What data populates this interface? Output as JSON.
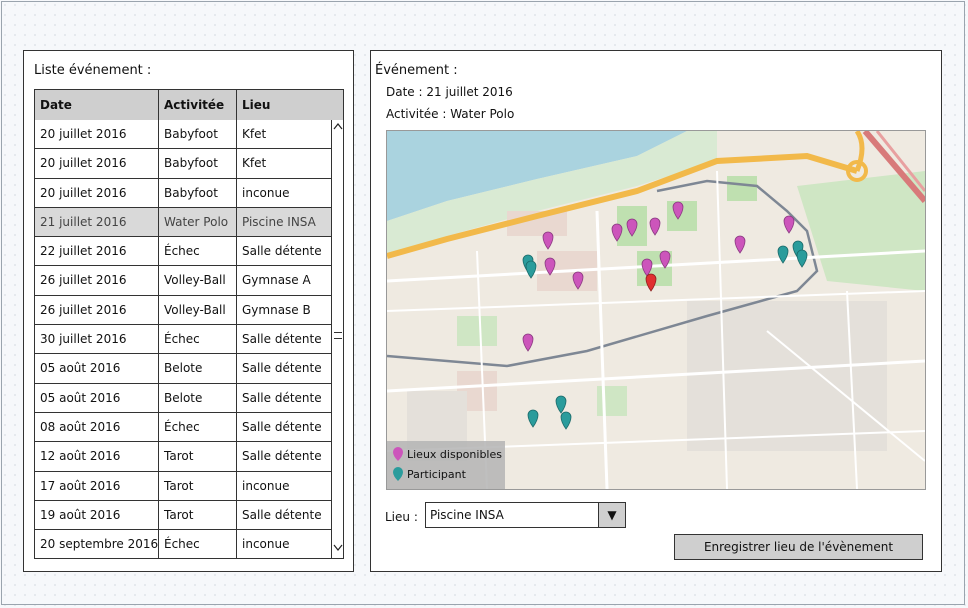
{
  "left_panel": {
    "title": "Liste événement :",
    "columns": [
      "Date",
      "Activitée",
      "Lieu"
    ],
    "rows": [
      {
        "date": "20 juillet 2016",
        "activity": "Babyfoot",
        "place": "Kfet",
        "selected": false
      },
      {
        "date": "20 juillet 2016",
        "activity": "Babyfoot",
        "place": "Kfet",
        "selected": false
      },
      {
        "date": "20 juillet 2016",
        "activity": "Babyfoot",
        "place": "inconue",
        "selected": false
      },
      {
        "date": "21 juillet 2016",
        "activity": "Water Polo",
        "place": "Piscine INSA",
        "selected": true
      },
      {
        "date": "22 juillet 2016",
        "activity": "Échec",
        "place": "Salle détente",
        "selected": false
      },
      {
        "date": "26 juillet 2016",
        "activity": "Volley-Ball",
        "place": "Gymnase A",
        "selected": false
      },
      {
        "date": "26 juillet 2016",
        "activity": "Volley-Ball",
        "place": "Gymnase B",
        "selected": false
      },
      {
        "date": "30 juillet 2016",
        "activity": "Échec",
        "place": "Salle détente",
        "selected": false
      },
      {
        "date": "05 août 2016",
        "activity": "Belote",
        "place": "Salle détente",
        "selected": false
      },
      {
        "date": "05 août 2016",
        "activity": "Belote",
        "place": "Salle détente",
        "selected": false
      },
      {
        "date": "08 août 2016",
        "activity": "Échec",
        "place": "Salle détente",
        "selected": false
      },
      {
        "date": "12 août 2016",
        "activity": "Tarot",
        "place": "Salle détente",
        "selected": false
      },
      {
        "date": "17 août 2016",
        "activity": "Tarot",
        "place": "inconue",
        "selected": false
      },
      {
        "date": "19 août 2016",
        "activity": "Tarot",
        "place": "Salle détente",
        "selected": false
      },
      {
        "date": "20 septembre 2016",
        "activity": "Échec",
        "place": "inconue",
        "selected": false
      }
    ],
    "scroll_up_icon": "chevron-up-icon",
    "scroll_down_icon": "chevron-down-icon"
  },
  "right_panel": {
    "title": "Événement :",
    "date_line": "Date : 21 juillet 2016",
    "activity_line": "Activitée : Water Polo",
    "map": {
      "legend": {
        "available_label": "Lieux disponibles",
        "participant_label": "Participant"
      },
      "colors": {
        "available": "#cc55bb",
        "participant": "#2a9c9c",
        "selected": "#e03030"
      }
    },
    "lieu_label": "Lieu :",
    "lieu_value": "Piscine INSA",
    "save_label": "Enregistrer lieu de l'évènement"
  }
}
